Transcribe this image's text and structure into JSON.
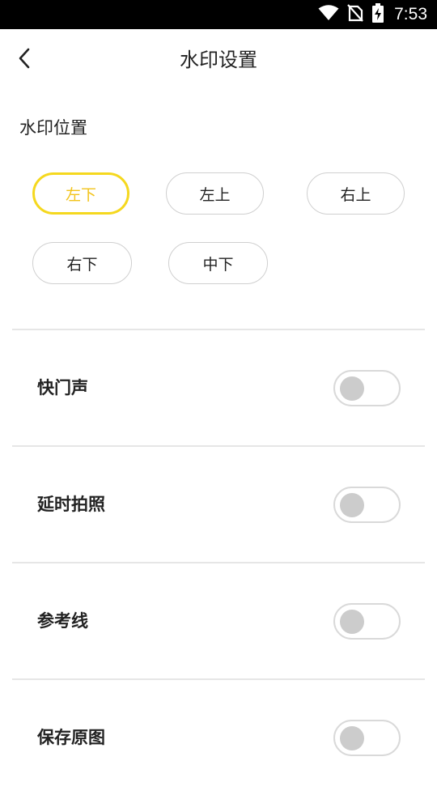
{
  "status_bar": {
    "time": "7:53",
    "icons": [
      "wifi-icon",
      "no-sim-icon",
      "battery-charging-icon"
    ]
  },
  "header": {
    "title": "水印设置",
    "back_icon": "chevron-left-icon"
  },
  "watermark_position": {
    "label": "水印位置",
    "options": [
      "左下",
      "左上",
      "右上",
      "右下",
      "中下"
    ],
    "selected": "左下",
    "accent_color": "#f5d81e"
  },
  "settings": [
    {
      "label": "快门声",
      "enabled": false
    },
    {
      "label": "延时拍照",
      "enabled": false
    },
    {
      "label": "参考线",
      "enabled": false
    },
    {
      "label": "保存原图",
      "enabled": false
    }
  ]
}
